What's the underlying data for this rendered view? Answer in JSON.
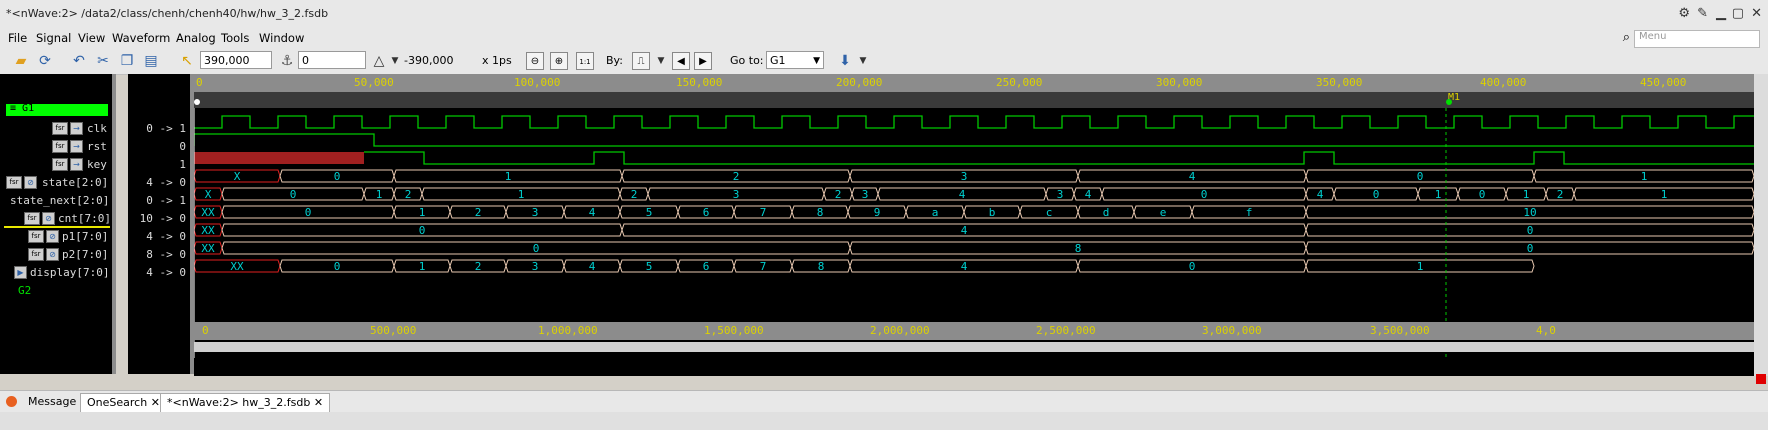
{
  "window": {
    "title": "*<nWave:2> /data2/class/chenh/chenh40/hw/hw_3_2.fsdb"
  },
  "menu": {
    "items": [
      "File",
      "Signal",
      "View",
      "Waveform",
      "Analog",
      "Tools",
      "Window"
    ],
    "search_placeholder": "Menu"
  },
  "toolbar": {
    "cursor_time": "390,000",
    "marker_time": "0",
    "delta": "-390,000",
    "unit": "x 1ps",
    "by_label": "By:",
    "goto_label": "Go to:",
    "goto_value": "G1"
  },
  "group": {
    "name": "G1"
  },
  "signals": [
    {
      "name": "clk",
      "value": "0 -> 1"
    },
    {
      "name": "rst",
      "value": "0"
    },
    {
      "name": "key",
      "value": "1"
    },
    {
      "name": "state[2:0]",
      "value": "4 -> 0"
    },
    {
      "name": "state_next[2:0]",
      "value": "0 -> 1"
    },
    {
      "name": "cnt[7:0]",
      "value": "10 -> 0"
    },
    {
      "name": "p1[7:0]",
      "value": "4 -> 0"
    },
    {
      "name": "p2[7:0]",
      "value": "8 -> 0"
    },
    {
      "name": "display[7:0]",
      "value": "4 -> 0"
    }
  ],
  "group2": {
    "name": "G2"
  },
  "marker": {
    "label": "M1"
  },
  "ruler_top": {
    "labels": [
      "0",
      "50,000",
      "100,000",
      "150,000",
      "200,000",
      "250,000",
      "300,000",
      "350,000",
      "400,000",
      "450,000"
    ]
  },
  "ruler_bottom": {
    "labels": [
      "0",
      "500,000",
      "1,000,000",
      "1,500,000",
      "2,000,000",
      "2,500,000",
      "3,000,000",
      "3,500,000",
      "4,0"
    ]
  },
  "bus_values": {
    "state": [
      "X",
      "0",
      "1",
      "2",
      "3",
      "4",
      "0",
      "1"
    ],
    "state_next": [
      "X",
      "0",
      "1",
      "2",
      "1",
      "2",
      "3",
      "2",
      "3",
      "4",
      "3",
      "4",
      "0",
      "4",
      "0",
      "1",
      "0",
      "1",
      "2",
      "1"
    ],
    "cnt": [
      "XX",
      "0",
      "1",
      "2",
      "3",
      "4",
      "5",
      "6",
      "7",
      "8",
      "9",
      "a",
      "b",
      "c",
      "d",
      "e",
      "f",
      "10",
      "0",
      "1"
    ],
    "p1": [
      "XX",
      "0",
      "4",
      "0"
    ],
    "p2": [
      "XX",
      "0",
      "8",
      "0"
    ],
    "display": [
      "XX",
      "0",
      "1",
      "2",
      "3",
      "4",
      "5",
      "6",
      "7",
      "8",
      "4",
      "0",
      "1"
    ]
  },
  "tabs": [
    {
      "label": "Message"
    },
    {
      "label": "OneSearch"
    },
    {
      "label": "*<nWave:2> hw_3_2.fsdb"
    }
  ],
  "colors": {
    "clock": "#00c800",
    "bus": "#e8c8b0",
    "text": "#00d0d0",
    "ruler_text": "#ddd200",
    "group": "#00ff00"
  }
}
